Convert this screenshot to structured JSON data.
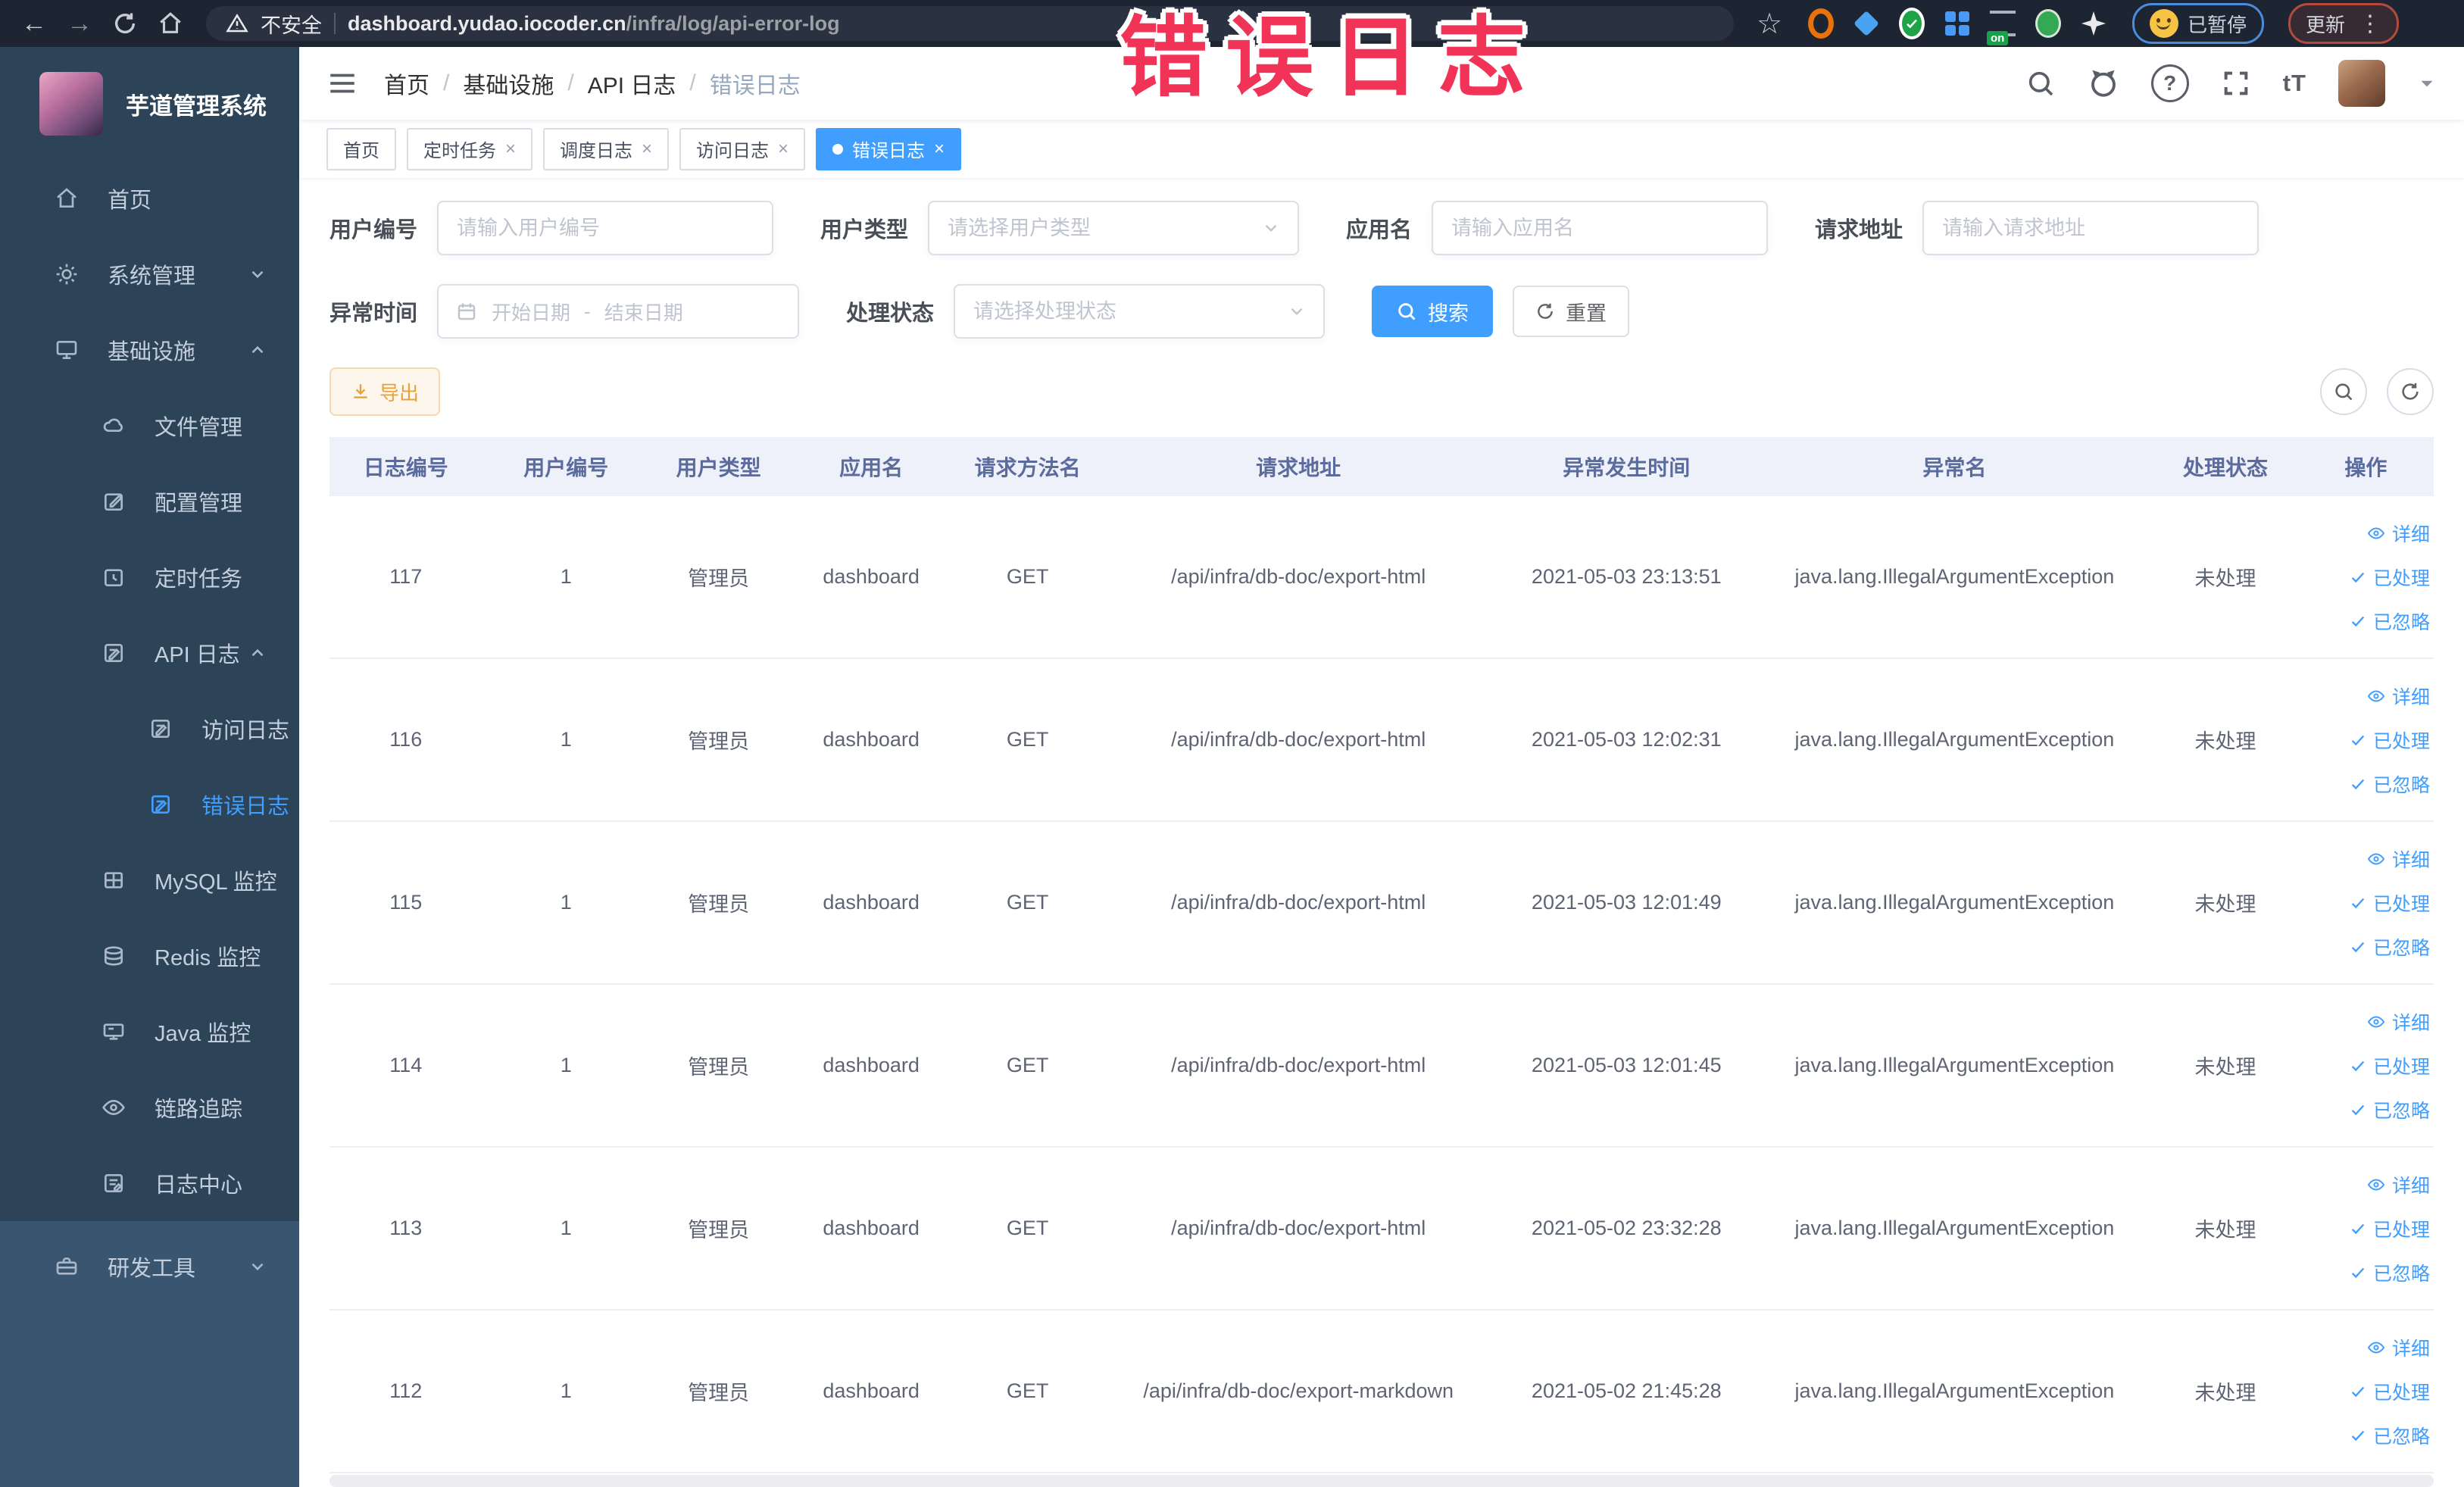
{
  "browser": {
    "security_label": "不安全",
    "url_domain": "dashboard.yudao.iocoder.cn",
    "url_path": "/infra/log/api-error-log",
    "profile_chip": "已暂停",
    "update_chip": "更新"
  },
  "annotation": "错误日志",
  "header": {
    "breadcrumb": [
      "首页",
      "基础设施",
      "API 日志",
      "错误日志"
    ]
  },
  "sidebar": {
    "title": "芋道管理系统",
    "items": [
      {
        "label": "首页"
      },
      {
        "label": "系统管理"
      },
      {
        "label": "基础设施"
      },
      {
        "label": "文件管理"
      },
      {
        "label": "配置管理"
      },
      {
        "label": "定时任务"
      },
      {
        "label": "API 日志"
      },
      {
        "label": "访问日志"
      },
      {
        "label": "错误日志"
      },
      {
        "label": "MySQL 监控"
      },
      {
        "label": "Redis 监控"
      },
      {
        "label": "Java 监控"
      },
      {
        "label": "链路追踪"
      },
      {
        "label": "日志中心"
      },
      {
        "label": "研发工具"
      }
    ]
  },
  "tabs": {
    "items": [
      {
        "label": "首页"
      },
      {
        "label": "定时任务"
      },
      {
        "label": "调度日志"
      },
      {
        "label": "访问日志"
      },
      {
        "label": "错误日志"
      }
    ]
  },
  "filters": {
    "user_id": {
      "label": "用户编号",
      "placeholder": "请输入用户编号"
    },
    "user_type": {
      "label": "用户类型",
      "placeholder": "请选择用户类型"
    },
    "app_name": {
      "label": "应用名",
      "placeholder": "请输入应用名"
    },
    "request_url": {
      "label": "请求地址",
      "placeholder": "请输入请求地址"
    },
    "exception_time": {
      "label": "异常时间",
      "start_placeholder": "开始日期",
      "separator": "-",
      "end_placeholder": "结束日期"
    },
    "process_status": {
      "label": "处理状态",
      "placeholder": "请选择处理状态"
    },
    "search_label": "搜索",
    "reset_label": "重置"
  },
  "toolbar": {
    "export_label": "导出"
  },
  "table": {
    "columns": [
      "日志编号",
      "用户编号",
      "用户类型",
      "应用名",
      "请求方法名",
      "请求地址",
      "异常发生时间",
      "异常名",
      "处理状态",
      "操作"
    ],
    "actions": {
      "detail": "详细",
      "processed": "已处理",
      "ignored": "已忽略"
    },
    "rows": [
      {
        "id": "117",
        "user_id": "1",
        "user_type": "管理员",
        "app_name": "dashboard",
        "method": "GET",
        "url": "/api/infra/db-doc/export-html",
        "time": "2021-05-03 23:13:51",
        "exception": "java.lang.IllegalArgumentException",
        "status": "未处理"
      },
      {
        "id": "116",
        "user_id": "1",
        "user_type": "管理员",
        "app_name": "dashboard",
        "method": "GET",
        "url": "/api/infra/db-doc/export-html",
        "time": "2021-05-03 12:02:31",
        "exception": "java.lang.IllegalArgumentException",
        "status": "未处理"
      },
      {
        "id": "115",
        "user_id": "1",
        "user_type": "管理员",
        "app_name": "dashboard",
        "method": "GET",
        "url": "/api/infra/db-doc/export-html",
        "time": "2021-05-03 12:01:49",
        "exception": "java.lang.IllegalArgumentException",
        "status": "未处理"
      },
      {
        "id": "114",
        "user_id": "1",
        "user_type": "管理员",
        "app_name": "dashboard",
        "method": "GET",
        "url": "/api/infra/db-doc/export-html",
        "time": "2021-05-03 12:01:45",
        "exception": "java.lang.IllegalArgumentException",
        "status": "未处理"
      },
      {
        "id": "113",
        "user_id": "1",
        "user_type": "管理员",
        "app_name": "dashboard",
        "method": "GET",
        "url": "/api/infra/db-doc/export-html",
        "time": "2021-05-02 23:32:28",
        "exception": "java.lang.IllegalArgumentException",
        "status": "未处理"
      },
      {
        "id": "112",
        "user_id": "1",
        "user_type": "管理员",
        "app_name": "dashboard",
        "method": "GET",
        "url": "/api/infra/db-doc/export-markdown",
        "time": "2021-05-02 21:45:28",
        "exception": "java.lang.IllegalArgumentException",
        "status": "未处理"
      }
    ]
  }
}
